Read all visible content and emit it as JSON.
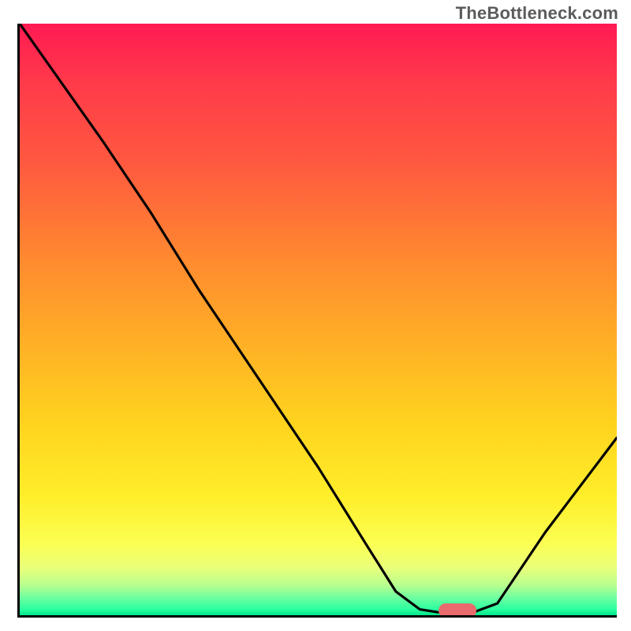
{
  "watermark": "TheBottleneck.com",
  "chart_data": {
    "type": "line",
    "title": "",
    "xlabel": "",
    "ylabel": "",
    "xlim": [
      0,
      100
    ],
    "ylim": [
      0,
      100
    ],
    "grid": false,
    "legend": false,
    "series": [
      {
        "name": "curve",
        "points": [
          {
            "x": 0,
            "y": 100
          },
          {
            "x": 14,
            "y": 80
          },
          {
            "x": 22,
            "y": 68
          },
          {
            "x": 30,
            "y": 55
          },
          {
            "x": 40,
            "y": 40
          },
          {
            "x": 50,
            "y": 25
          },
          {
            "x": 58,
            "y": 12
          },
          {
            "x": 63,
            "y": 4
          },
          {
            "x": 67,
            "y": 1
          },
          {
            "x": 70,
            "y": 0.5
          },
          {
            "x": 76,
            "y": 0.5
          },
          {
            "x": 80,
            "y": 2
          },
          {
            "x": 88,
            "y": 14
          },
          {
            "x": 100,
            "y": 30
          }
        ]
      }
    ],
    "marker": {
      "name": "highlight-pill",
      "x": 73,
      "y": 0.5,
      "color": "#ea6a6d"
    },
    "background": {
      "type": "vertical-gradient",
      "stops": [
        {
          "pos": 0,
          "color": "#ff1a52"
        },
        {
          "pos": 0.5,
          "color": "#ffb225"
        },
        {
          "pos": 0.85,
          "color": "#fbff53"
        },
        {
          "pos": 1.0,
          "color": "#00e78b"
        }
      ]
    }
  }
}
